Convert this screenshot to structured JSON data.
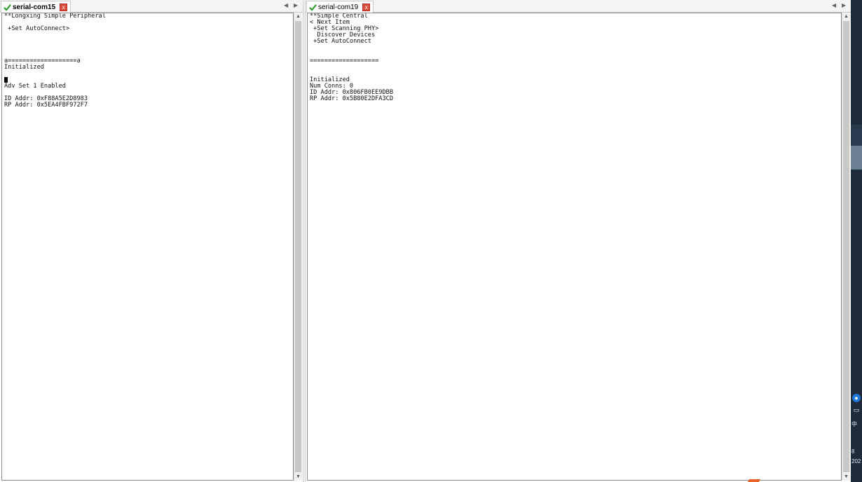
{
  "panes": [
    {
      "tab_label": "serial-com15",
      "close_glyph": "x",
      "lines": [
        "**Longxing Simple Peripheral",
        "",
        " +Set AutoConnect>",
        "",
        "",
        "",
        "",
        "a===================a",
        "Initialized",
        "",
        "",
        "Adv Set 1 Enabled",
        "",
        "ID Addr: 0xF88A5E2D8983",
        "RP Addr: 0x5EA4FBF972F7"
      ]
    },
    {
      "tab_label": "serial-com19",
      "close_glyph": "x",
      "lines": [
        "**Simple Central",
        "< Next Item",
        " +Set Scanning PHY>",
        "  Discover Devices",
        " +Set AutoConnect",
        "",
        "",
        "===================",
        "",
        "",
        "Initialized",
        "Num Conns: 0",
        "ID Addr: 0x806FB0EE9DBB",
        "RP Addr: 0x5B80E2DFA3CD"
      ]
    }
  ],
  "tab_nav": {
    "prev": "◀",
    "next": "▶"
  },
  "scroll": {
    "up": "▲",
    "down": "▼"
  },
  "taskbar": {
    "ime_text": "中",
    "clock_partial_1": "8",
    "clock_partial_2": "202"
  },
  "colors": {
    "check": "#2f9e2f",
    "close": "#d94a3f",
    "accent": "#1e78d7"
  }
}
